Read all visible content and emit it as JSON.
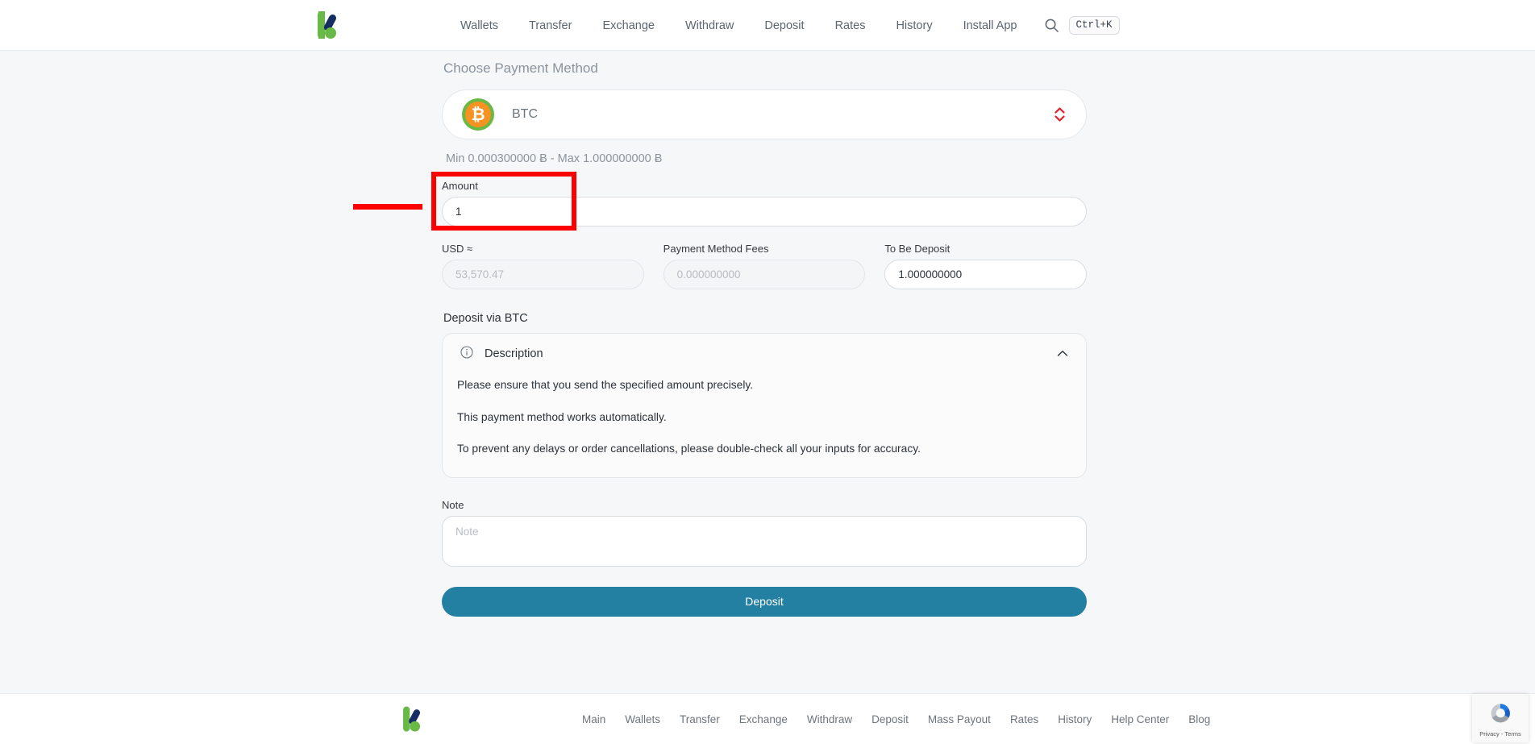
{
  "header": {
    "logo_alt": "Kuna logo",
    "nav": [
      {
        "label": "Wallets"
      },
      {
        "label": "Transfer"
      },
      {
        "label": "Exchange"
      },
      {
        "label": "Withdraw"
      },
      {
        "label": "Deposit"
      },
      {
        "label": "Rates"
      },
      {
        "label": "History"
      },
      {
        "label": "Install App"
      }
    ],
    "search_icon": "search-icon",
    "shortcut_badge": "Ctrl+K"
  },
  "form": {
    "choose_payment_method_label": "Choose Payment Method",
    "payment_method": {
      "coin_symbol": "₿",
      "name": "BTC",
      "coin_ring_color": "#69b946",
      "coin_fill_color": "#f59221",
      "caret_color": "#e8202a"
    },
    "limits": {
      "min_prefix": "Min",
      "min_value": "0.000300000 Ƀ",
      "separator": "-",
      "max_prefix": "Max",
      "max_value": "1.000000000 Ƀ",
      "full_text": "Min 0.000300000 Ƀ   - Max 1.000000000 Ƀ"
    },
    "amount": {
      "label": "Amount",
      "value": "1",
      "placeholder": "Amount"
    },
    "usd": {
      "label": "USD ≈",
      "value": "",
      "placeholder": "53,570.47"
    },
    "fees": {
      "label": "Payment Method Fees",
      "value": "",
      "placeholder": "0.000000000"
    },
    "to_be_deposit": {
      "label": "To Be Deposit",
      "value": "1.000000000",
      "placeholder": "0.000000000"
    },
    "deposit_via_title": "Deposit via BTC",
    "description": {
      "icon": "info-circle-icon",
      "title": "Description",
      "expanded": true,
      "paragraphs": [
        "Please ensure that you send the specified amount precisely.",
        "This payment method works automatically.",
        "To prevent any delays or order cancellations, please double-check all your inputs for accuracy."
      ]
    },
    "note": {
      "label": "Note",
      "value": "",
      "placeholder": "Note"
    },
    "submit_label": "Deposit",
    "submit_color": "#2380a3"
  },
  "annotation": {
    "color": "#ff0000",
    "target": "amount-field"
  },
  "footer": {
    "logo_alt": "Kuna logo",
    "links": [
      {
        "label": "Main"
      },
      {
        "label": "Wallets"
      },
      {
        "label": "Transfer"
      },
      {
        "label": "Exchange"
      },
      {
        "label": "Withdraw"
      },
      {
        "label": "Deposit"
      },
      {
        "label": "Mass Payout"
      },
      {
        "label": "Rates"
      },
      {
        "label": "History"
      },
      {
        "label": "Help Center"
      },
      {
        "label": "Blog"
      }
    ]
  },
  "recaptcha": {
    "text": "Privacy - Terms"
  }
}
